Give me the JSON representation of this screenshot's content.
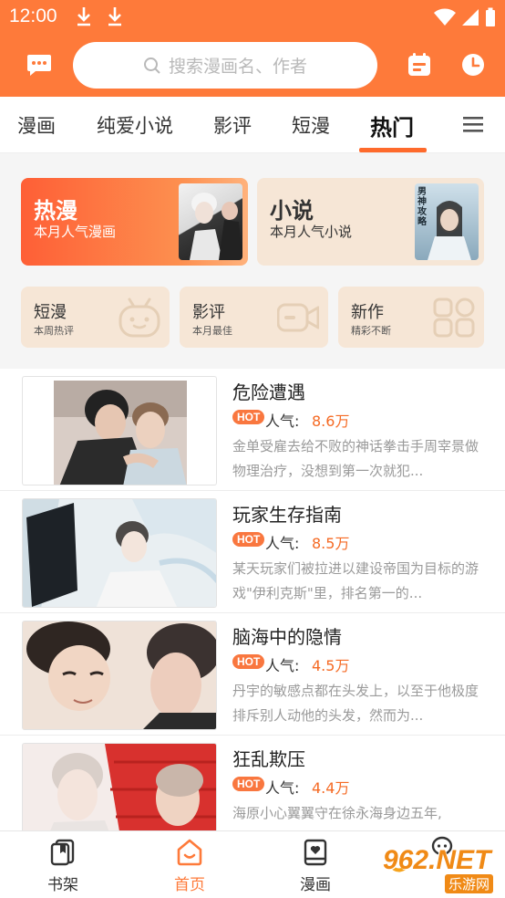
{
  "status": {
    "time": "12:00"
  },
  "search": {
    "placeholder": "搜索漫画名、作者"
  },
  "tabs": [
    {
      "label": "漫画"
    },
    {
      "label": "纯爱小说"
    },
    {
      "label": "影评"
    },
    {
      "label": "短漫"
    },
    {
      "label": "热门",
      "active": true
    }
  ],
  "feature_cards": [
    {
      "title": "热漫",
      "subtitle": "本月人气漫画"
    },
    {
      "title": "小说",
      "subtitle": "本月人气小说",
      "cover_text": "男神攻略"
    }
  ],
  "small_cards": [
    {
      "title": "短漫",
      "subtitle": "本周热评",
      "icon": "robot-face-icon"
    },
    {
      "title": "影评",
      "subtitle": "本月最佳",
      "icon": "video-camera-icon"
    },
    {
      "title": "新作",
      "subtitle": "精彩不断",
      "icon": "grid-icon"
    }
  ],
  "list": [
    {
      "title": "危险遭遇",
      "badge": "HOT",
      "pop_label": "人气:",
      "pop": "8.6万",
      "desc": "金单受雇去给不败的神话拳击手周宰景做物理治疗，没想到第一次就犯..."
    },
    {
      "title": "玩家生存指南",
      "badge": "HOT",
      "pop_label": "人气:",
      "pop": "8.5万",
      "desc": "某天玩家们被拉进以建设帝国为目标的游戏\"伊利克斯\"里，排名第一的..."
    },
    {
      "title": "脑海中的隐情",
      "badge": "HOT",
      "pop_label": "人气:",
      "pop": "4.5万",
      "desc": "丹宇的敏感点都在头发上，以至于他极度排斥别人动他的头发，然而为..."
    },
    {
      "title": "狂乱欺压",
      "badge": "HOT",
      "pop_label": "人气:",
      "pop": "4.4万",
      "desc": "海原小心翼翼守在徐永海身边五年,"
    }
  ],
  "bottom_nav": [
    {
      "label": "书架",
      "icon": "bookshelf-icon"
    },
    {
      "label": "首页",
      "icon": "home-icon",
      "active": true
    },
    {
      "label": "漫画",
      "icon": "comic-book-icon"
    },
    {
      "label": "",
      "icon": "chat-bubble-icon"
    }
  ],
  "watermark": {
    "text": "962.NET",
    "sub": "乐游网"
  },
  "colors": {
    "accent": "#fe7a3a",
    "hot_badge": "#f9773f",
    "popularity": "#f56a24"
  }
}
